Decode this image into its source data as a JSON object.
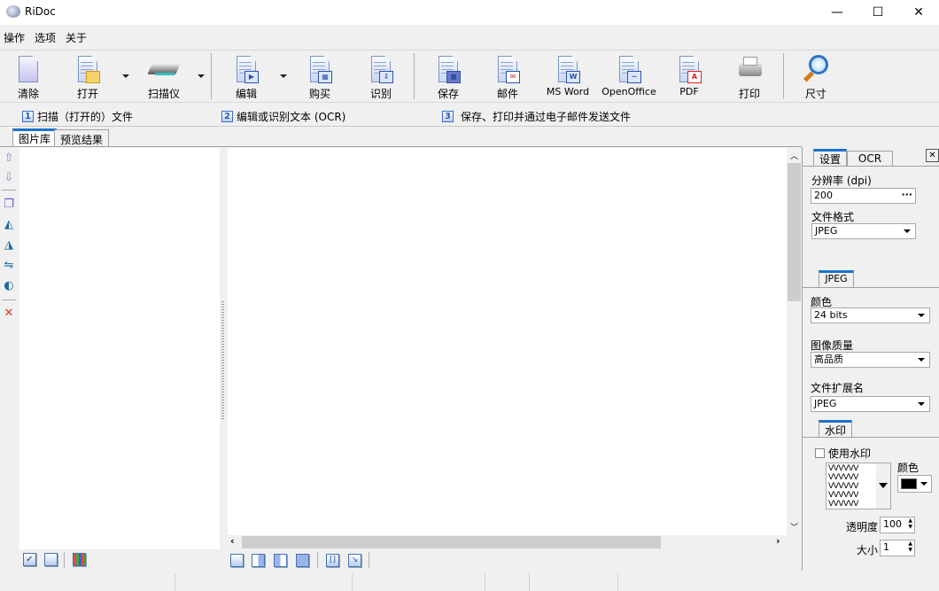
{
  "window": {
    "title": "RiDoc",
    "minimize": "—",
    "maximize": "☐",
    "close": "✕"
  },
  "menu": [
    "操作",
    "选项",
    "关于"
  ],
  "toolbar": {
    "clear": "清除",
    "open": "打开",
    "scanner": "扫描仪",
    "edit": "编辑",
    "buy": "购买",
    "recognize": "识别",
    "save": "保存",
    "mail": "邮件",
    "msword": "MS Word",
    "openoffice": "OpenOffice",
    "pdf": "PDF",
    "print": "打印",
    "size": "尺寸"
  },
  "steps": [
    {
      "num": "1",
      "label": "扫描（打开的）文件"
    },
    {
      "num": "2",
      "label": "编辑或识别文本 (OCR)"
    },
    {
      "num": "3",
      "label": "保存、打印并通过电子邮件发送文件"
    }
  ],
  "left_tabs": [
    "图片库",
    "预览结果"
  ],
  "panel": {
    "tabs": [
      "设置",
      "OCR"
    ],
    "close": "✕",
    "resolution_label": "分辨率 (dpi)",
    "resolution_value": "200",
    "browse": "···",
    "format_label": "文件格式",
    "format_value": "JPEG",
    "jpeg_tab": "JPEG",
    "color_label": "颜色",
    "color_value": "24 bits",
    "quality_label": "图像质量",
    "quality_value": "高品质",
    "ext_label": "文件扩展名",
    "ext_value": "JPEG",
    "watermark_tab": "水印",
    "use_watermark": "使用水印",
    "use_watermark_checked": false,
    "watermark_pattern": "VVVVVV",
    "wm_color_label": "颜色",
    "wm_color": "#000000",
    "opacity_label": "透明度",
    "opacity_value": "100",
    "size_label": "大小",
    "size_value": "1"
  }
}
